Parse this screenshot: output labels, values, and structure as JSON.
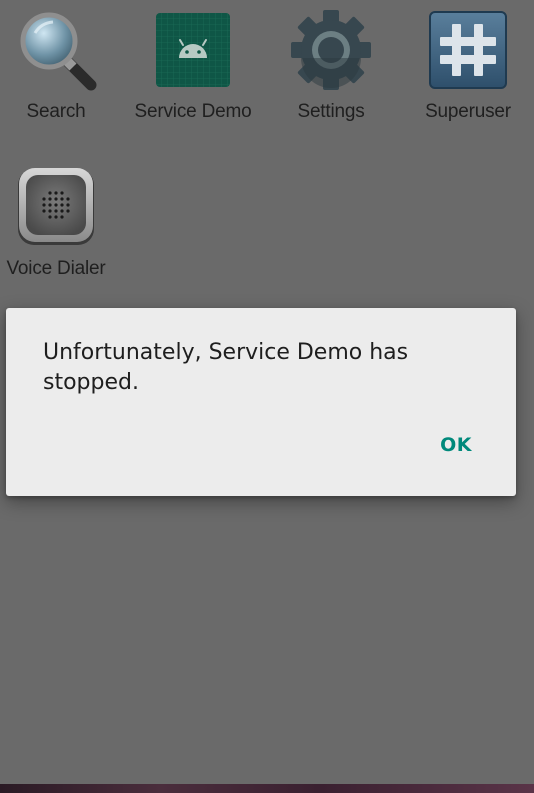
{
  "apps": [
    {
      "label": "Search",
      "icon": "search-icon"
    },
    {
      "label": "Service Demo",
      "icon": "android-icon"
    },
    {
      "label": "Settings",
      "icon": "gear-icon"
    },
    {
      "label": "Superuser",
      "icon": "hash-icon"
    },
    {
      "label": "Voice Dialer",
      "icon": "speaker-icon"
    }
  ],
  "dialog": {
    "message": "Unfortunately, Service Demo has stopped.",
    "ok_label": "OK"
  },
  "colors": {
    "accent": "#00897b",
    "dialog_background": "#ececec",
    "scrim": "#666666"
  }
}
